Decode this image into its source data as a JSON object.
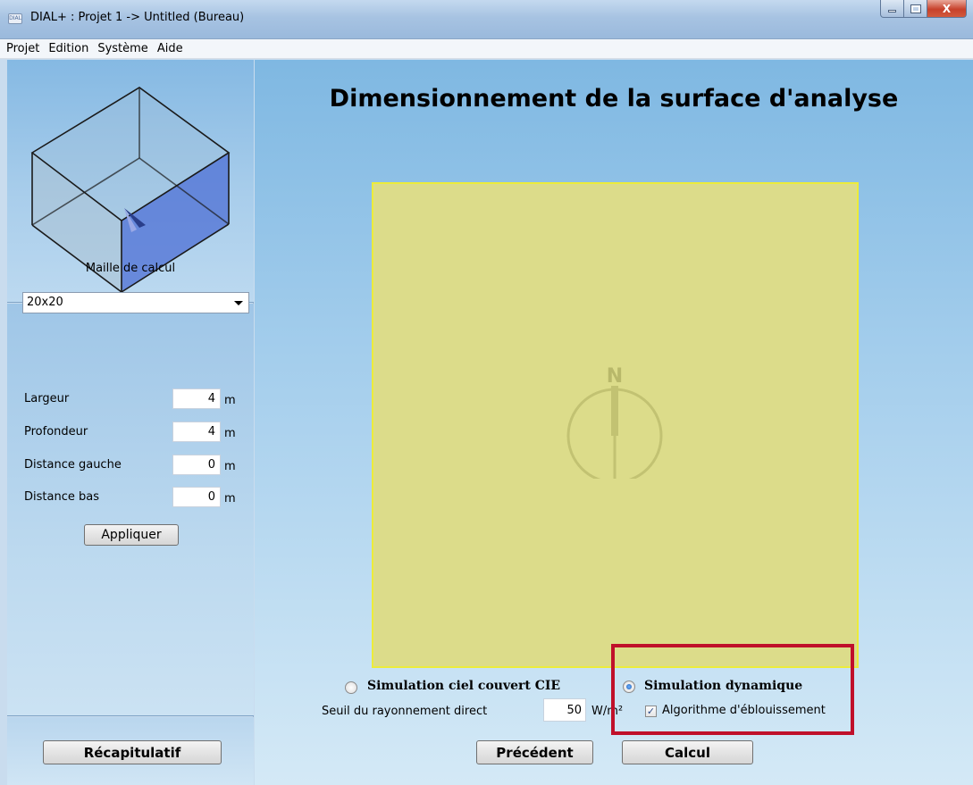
{
  "window": {
    "title": "DIAL+ : Projet 1 -> Untitled (Bureau)",
    "app_icon": "DIAL",
    "close_label": "X"
  },
  "menu": [
    "Projet",
    "Edition",
    "Système",
    "Aide"
  ],
  "sidebar": {
    "maille_label": "Maille de calcul",
    "maille_value": "20x20",
    "fields": [
      {
        "label": "Largeur",
        "value": "4",
        "unit": "m"
      },
      {
        "label": "Profondeur",
        "value": "4",
        "unit": "m"
      },
      {
        "label": "Distance gauche",
        "value": "0",
        "unit": "m"
      },
      {
        "label": "Distance bas",
        "value": "0",
        "unit": "m"
      }
    ],
    "apply_label": "Appliquer",
    "recap_label": "Récapitulatif"
  },
  "main": {
    "heading": "Dimensionnement de la surface d'analyse",
    "compass_letter": "N",
    "sim_cie_label": "Simulation ciel couvert CIE",
    "sim_dyn_label": "Simulation dynamique",
    "seuil_label": "Seuil du rayonnement direct",
    "seuil_value": "50",
    "seuil_unit": "W/m²",
    "glare_label": "Algorithme d'éblouissement",
    "prev_label": "Précédent",
    "calc_label": "Calcul"
  },
  "colors": {
    "surface_fill": "#dcdc8a",
    "surface_border": "#ecec3a",
    "highlight": "#c0102a"
  }
}
